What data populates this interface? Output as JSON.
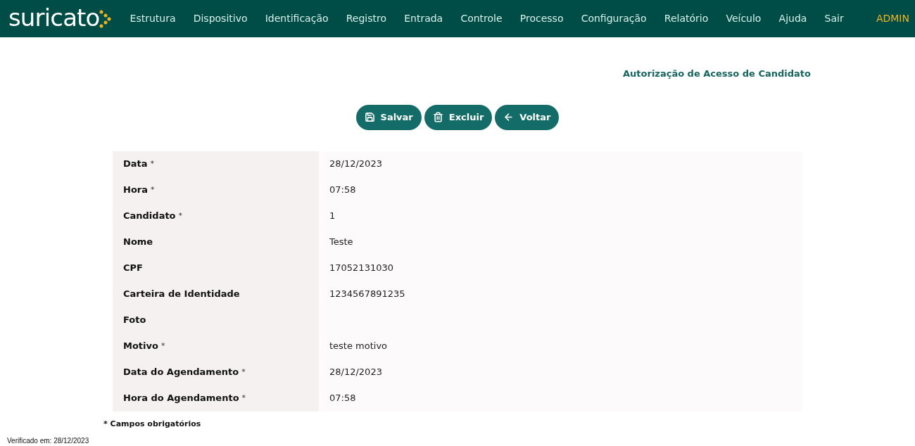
{
  "navbar": {
    "logo": "suricato",
    "items": [
      "Estrutura",
      "Dispositivo",
      "Identificação",
      "Registro",
      "Entrada",
      "Controle",
      "Processo",
      "Configuração",
      "Relatório",
      "Veículo",
      "Ajuda",
      "Sair"
    ],
    "user": "ADMIN"
  },
  "page_title": "Autorização de Acesso de Candidato",
  "buttons": [
    {
      "kind": "save",
      "label": "Salvar"
    },
    {
      "kind": "delete",
      "label": "Excluir"
    },
    {
      "kind": "back",
      "label": "Voltar"
    }
  ],
  "fields": [
    {
      "label": "Data",
      "mark": "*",
      "value": "28/12/2023"
    },
    {
      "label": "Hora",
      "mark": "*",
      "value": "07:58"
    },
    {
      "label": "Candidato",
      "mark": "*",
      "value": "1"
    },
    {
      "label": "Nome",
      "value": "Teste"
    },
    {
      "label": "CPF",
      "value": "17052131030"
    },
    {
      "label": "Carteira de Identidade",
      "value": "1234567891235"
    },
    {
      "label": "Foto"
    },
    {
      "label": "Motivo",
      "mark": "*",
      "value": "teste motivo"
    },
    {
      "label": "Data do Agendamento",
      "mark": "*",
      "value": "28/12/2023"
    },
    {
      "label": "Hora do Agendamento",
      "mark": "*",
      "value": "07:58"
    }
  ],
  "required_note": "* Campos obrigatórios",
  "verified": "Verificado em: 28/12/2023"
}
